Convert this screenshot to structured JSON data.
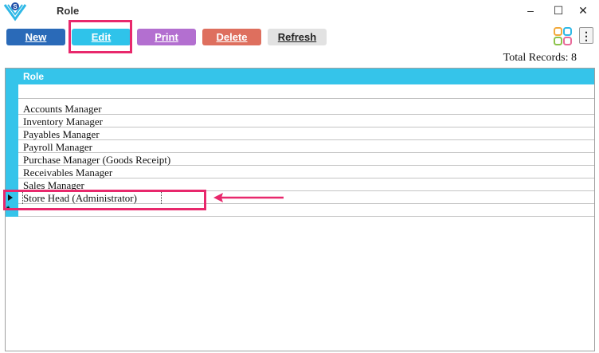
{
  "window": {
    "title": "Role",
    "app_icon": "app-logo-icon",
    "controls": {
      "minimize": "–",
      "maximize": "☐",
      "close": "✕"
    }
  },
  "toolbar": {
    "new_label": "New",
    "edit_label": "Edit",
    "print_label": "Print",
    "delete_label": "Delete",
    "refresh_label": "Refresh",
    "apps_icon": "apps-grid-icon",
    "more_icon": "⋮"
  },
  "summary": {
    "total_records": "Total Records: 8"
  },
  "grid": {
    "columns": [
      "Role"
    ],
    "rows": [
      "Accounts Manager",
      "Inventory Manager",
      "Payables Manager",
      "Payroll Manager",
      "Purchase Manager (Goods Receipt)",
      "Receivables Manager",
      "Sales Manager",
      "Store Head (Administrator)"
    ],
    "selected_row": 7,
    "new_row_marker": "*"
  },
  "colors": {
    "header": "#35c4ea",
    "new": "#2a6ab8",
    "edit": "#2fc3ea",
    "print": "#b36fd0",
    "delete": "#de6f5e",
    "refresh": "#e2e2e2",
    "annotation": "#e8286c"
  }
}
